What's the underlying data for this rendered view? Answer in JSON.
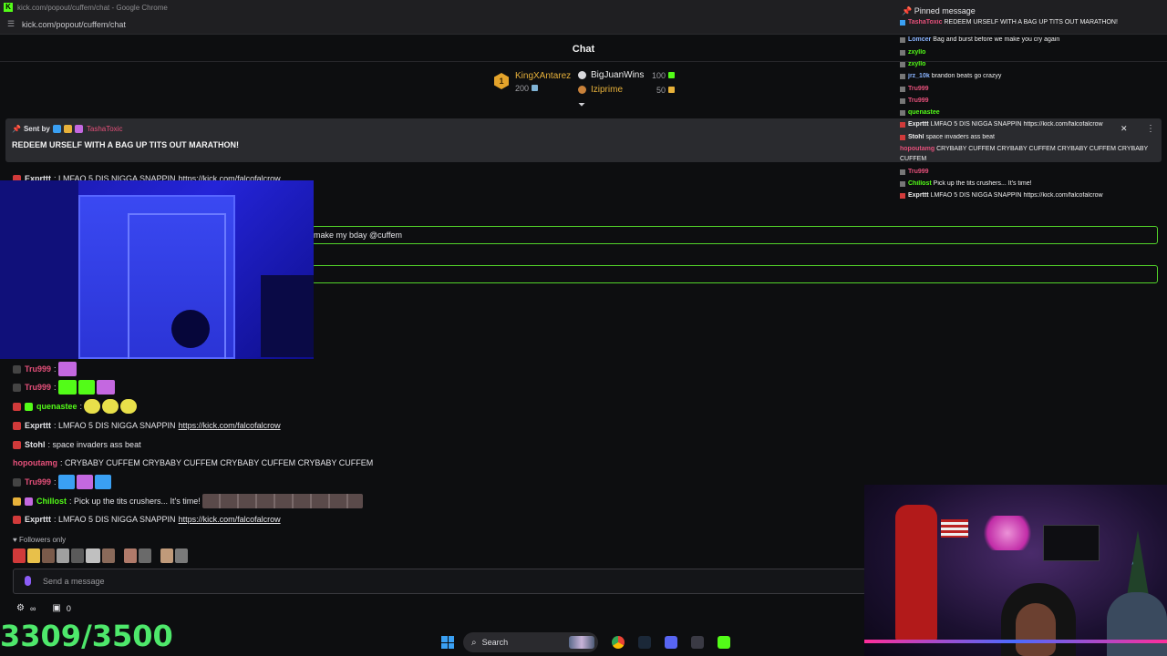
{
  "window": {
    "title": "kick.com/popout/cuffem/chat - Google Chrome",
    "url": "kick.com/popout/cuffem/chat"
  },
  "chat": {
    "title": "Chat",
    "leaderboard": {
      "first": {
        "name": "KingXAntarez",
        "value": "200",
        "rank": "1"
      },
      "second": {
        "name": "BigJuanWins",
        "value": "100"
      },
      "third": {
        "name": "Iziprime",
        "value": "50"
      }
    },
    "pinned": {
      "sent_by_label": "Sent by",
      "sender": "TashaToxic",
      "text": "REDEEM URSELF WITH A BAG UP TITS OUT MARATHON!"
    },
    "messages": [
      {
        "user": "Exprttt",
        "color": "#e8e8ec",
        "text": "LMFAO 5 DIS NIGGA SNAPPIN",
        "link": "https://kick.com/falcofalcrow"
      },
      {
        "user": "",
        "color": "#e8e8ec",
        "text": "make my bday @cuffem",
        "link": ""
      },
      {
        "user": "Tru999",
        "color": "#e5507a",
        "text": "",
        "link": ""
      },
      {
        "user": "Tru999",
        "color": "#e5507a",
        "text": "",
        "link": ""
      },
      {
        "user": "quenastee",
        "color": "#53fc18",
        "text": "",
        "link": ""
      },
      {
        "user": "Exprttt",
        "color": "#e8e8ec",
        "text": "LMFAO 5 DIS NIGGA SNAPPIN",
        "link": "https://kick.com/falcofalcrow"
      },
      {
        "user": "Stohl",
        "color": "#e8e8ec",
        "text": "space invaders ass beat",
        "link": ""
      },
      {
        "user": "hopoutamg",
        "color": "#e5507a",
        "text": "CRYBABY CUFFEM CRYBABY CUFFEM CRYBABY CUFFEM CRYBABY CUFFEM",
        "link": ""
      },
      {
        "user": "Tru999",
        "color": "#e5507a",
        "text": "",
        "link": ""
      },
      {
        "user": "Chillost",
        "color": "#53fc18",
        "text": "Pick up the tits crushers... It's time!",
        "link": ""
      },
      {
        "user": "Exprttt",
        "color": "#e8e8ec",
        "text": "LMFAO 5 DIS NIGGA SNAPPIN",
        "link": "https://kick.com/falcofalcrow"
      }
    ],
    "followers_only": "Followers only",
    "input_placeholder": "Send a message",
    "bottom_infinity": "∞",
    "bottom_count": "0",
    "counter": "3309/3500"
  },
  "overlay_chat": {
    "title": "Pinned message",
    "lines": [
      {
        "user": "TashaToxic",
        "color": "#e5507a",
        "text": "REDEEM URSELF WITH A BAG UP TITS OUT MARATHON!"
      },
      {
        "user": "Lomcer",
        "color": "#8ab4ff",
        "text": "Bag and burst before we make you cry again"
      },
      {
        "user": "zxyllo",
        "color": "#53fc18",
        "text": ""
      },
      {
        "user": "zxyllo",
        "color": "#53fc18",
        "text": ""
      },
      {
        "user": "jrz_10k",
        "color": "#8ab4ff",
        "text": "brandon beats go crazyy"
      },
      {
        "user": "Tru999",
        "color": "#e5507a",
        "text": ""
      },
      {
        "user": "Tru999",
        "color": "#e5507a",
        "text": ""
      },
      {
        "user": "quenastee",
        "color": "#53fc18",
        "text": ""
      },
      {
        "user": "Exprttt",
        "color": "#f0f0f0",
        "text": "LMFAO 5 DIS NIGGA SNAPPIN https://kick.com/falcofalcrow"
      },
      {
        "user": "Stohl",
        "color": "#f0f0f0",
        "text": "space invaders ass beat"
      },
      {
        "user": "hopoutamg",
        "color": "#e5507a",
        "text": "CRYBABY CUFFEM CRYBABY CUFFEM CRYBABY CUFFEM CRYBABY"
      },
      {
        "user": "",
        "color": "#f0f0f0",
        "text": "CUFFEM"
      },
      {
        "user": "Tru999",
        "color": "#e5507a",
        "text": ""
      },
      {
        "user": "Chillost",
        "color": "#53fc18",
        "text": "Pick up the tits crushers... It's time!"
      },
      {
        "user": "Exprttt",
        "color": "#f0f0f0",
        "text": "LMFAO 5 DIS NIGGA SNAPPIN https://kick.com/falcofalcrow"
      }
    ]
  },
  "taskbar": {
    "search_label": "Search"
  },
  "colors": {
    "accent": "#53fc18",
    "counter": "#4ee86b",
    "pink_user": "#e5507a"
  }
}
